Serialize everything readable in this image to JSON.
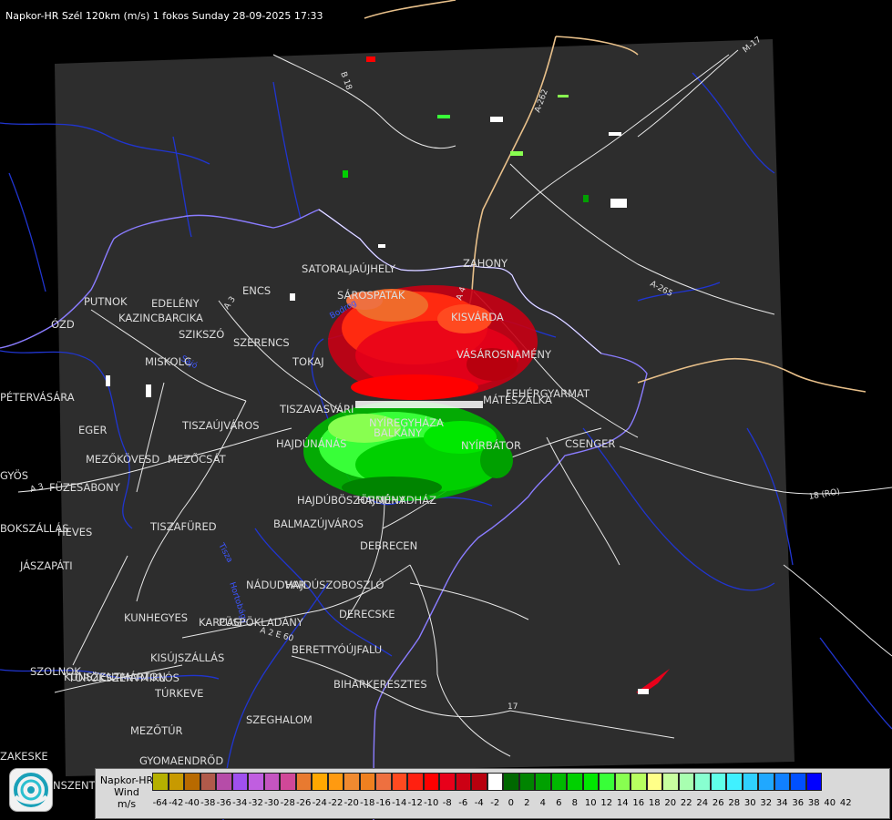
{
  "title": "Napkor-HR Szél 120km (m/s) 1 fokos Sunday 28-09-2025 17:33",
  "road_labels": [
    "B 18",
    "A-262",
    "M-17",
    "A-265",
    "18 (RO)",
    "A 3",
    "A 3",
    "A 4",
    "A 2 E 60",
    "17"
  ],
  "river_labels": [
    "Tisza",
    "Bodrog",
    "Sajó",
    "Hortobágy"
  ],
  "places": [
    "SATORALJAÚJHELY",
    "ZAHONY",
    "PUTNOK",
    "EDELÉNY",
    "KAZINCBARCIKA",
    "ENCS",
    "SÁROSPATAK",
    "KISVÁRDA",
    "SZIKSZÓ",
    "SZERENCS",
    "TOKAJ",
    "VÁSÁROSNAMÉNY",
    "ÓZD",
    "MISKOLC",
    "PÉTERVÁSÁRA",
    "FEHÉRGYARMAT",
    "MÁTÉSZALKA",
    "TISZAVASVÁRI",
    "NYÍREGYHÁZA",
    "EGER",
    "TISZAÚJVÁROS",
    "BALKÁNY",
    "HAJDÚNÁNÁS",
    "NYÍRBÁTOR",
    "CSENGER",
    "MEZŐKÖVESD",
    "MEZŐCSÁT",
    "GYÖS",
    "FÜZESABONY",
    "HAJDÚBÖSZÖRMÉNY",
    "HAJDÚHADHÁZ",
    "HEVES",
    "TISZAFÜRED",
    "BALMAZÚJVÁROS",
    "BOKSZÁLLÁS",
    "DEBRECEN",
    "JÁSZAPÁTI",
    "NÁDUDVAR",
    "HAJDÚSZOBOSZLÓ",
    "KUNHEGYES",
    "KARCAG",
    "PÜSPÖKLADÁNY",
    "DERECSKE",
    "BERETTYÓÚJFALU",
    "KUNSZENTMÁRTON",
    "KISÚJSZÁLLÁS",
    "SZOLNOK",
    "TÖRÖKSZENTMIKLÓS",
    "BIHARKERESZTES",
    "TÚRKEVE",
    "SZEGHALOM",
    "MEZŐTÚR",
    "ZAKESKE",
    "GYOMAENDRŐD",
    "NSZENTN"
  ],
  "legend": {
    "name": "Napkor-HR",
    "quantity": "Wind",
    "unit": "m/s",
    "ticks": [
      "-64",
      "-42",
      "-40",
      "-38",
      "-36",
      "-34",
      "-32",
      "-30",
      "-28",
      "-26",
      "-24",
      "-22",
      "-20",
      "-18",
      "-16",
      "-14",
      "-12",
      "-10",
      "-8",
      "-6",
      "-4",
      "-2",
      "0",
      "2",
      "4",
      "6",
      "8",
      "10",
      "12",
      "14",
      "16",
      "18",
      "20",
      "22",
      "24",
      "26",
      "28",
      "30",
      "32",
      "34",
      "36",
      "38",
      "40",
      "42"
    ],
    "colors": [
      "#b5b000",
      "#c89a00",
      "#b86a00",
      "#b05a4a",
      "#b64ca8",
      "#a050ee",
      "#c05ee0",
      "#c455c0",
      "#d04898",
      "#e87a30",
      "#ffa800",
      "#ff9a10",
      "#f08a30",
      "#ef8020",
      "#ee7040",
      "#ff4a20",
      "#ff2010",
      "#ff0000",
      "#e8001a",
      "#cc0014",
      "#b8000e",
      "#ffffff",
      "#006800",
      "#008400",
      "#00a000",
      "#00b800",
      "#00d000",
      "#00e800",
      "#38ff38",
      "#88ff50",
      "#b8ff60",
      "#ffff88",
      "#c8ffa0",
      "#a8ffb0",
      "#88ffd0",
      "#60ffe8",
      "#40f0ff",
      "#30d0ff",
      "#20a8ff",
      "#1080ff",
      "#0050ff",
      "#0000ff"
    ]
  }
}
